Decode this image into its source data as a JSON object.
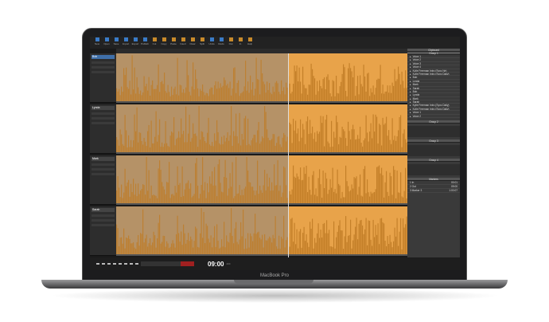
{
  "toolbar": {
    "buttons": [
      "New",
      "Open",
      "Save",
      "Import",
      "Export",
      "Publish",
      "Cut",
      "Copy",
      "Paste",
      "Insert",
      "Clear",
      "Split",
      "Undo",
      "Redo",
      "Out",
      "In",
      "Help"
    ]
  },
  "tracks": [
    {
      "name": "Bob"
    },
    {
      "name": "Lynda"
    },
    {
      "name": "Mark"
    },
    {
      "name": "Sarah"
    }
  ],
  "panel": {
    "title": "Clipboard",
    "group1": "Group 1",
    "items": [
      "Voice 1",
      "Voice 2",
      "Voice 3",
      "Voice 4",
      "Kylie Freeman Intro (Sync Ne)",
      "Kylie Freeman Intro (Sync Daily)",
      "Bob",
      "Lynda",
      "Mark",
      "Sarah",
      "Bob",
      "Lynda",
      "Mark",
      "Sarah",
      "Kylie Freeman Intro (Sync Daily)",
      "Kylie Freeman Intro (Sync Daily)",
      "Voice 1",
      "Voice 2"
    ],
    "groups": [
      "Group 2",
      "Group 3",
      "Group 4"
    ],
    "markers_title": "Markers",
    "markers": [
      {
        "label": "1 In",
        "time": "00:01"
      },
      {
        "label": "2 Out",
        "time": "09:00"
      },
      {
        "label": "3 Marker 3",
        "time": "1:00:07"
      }
    ]
  },
  "transport": {
    "timecode": "09:00",
    "frames": "200"
  },
  "device_label": "MacBook Pro",
  "colors": {
    "waveform": "#e8a34a",
    "accent": "#3a7bc8"
  }
}
